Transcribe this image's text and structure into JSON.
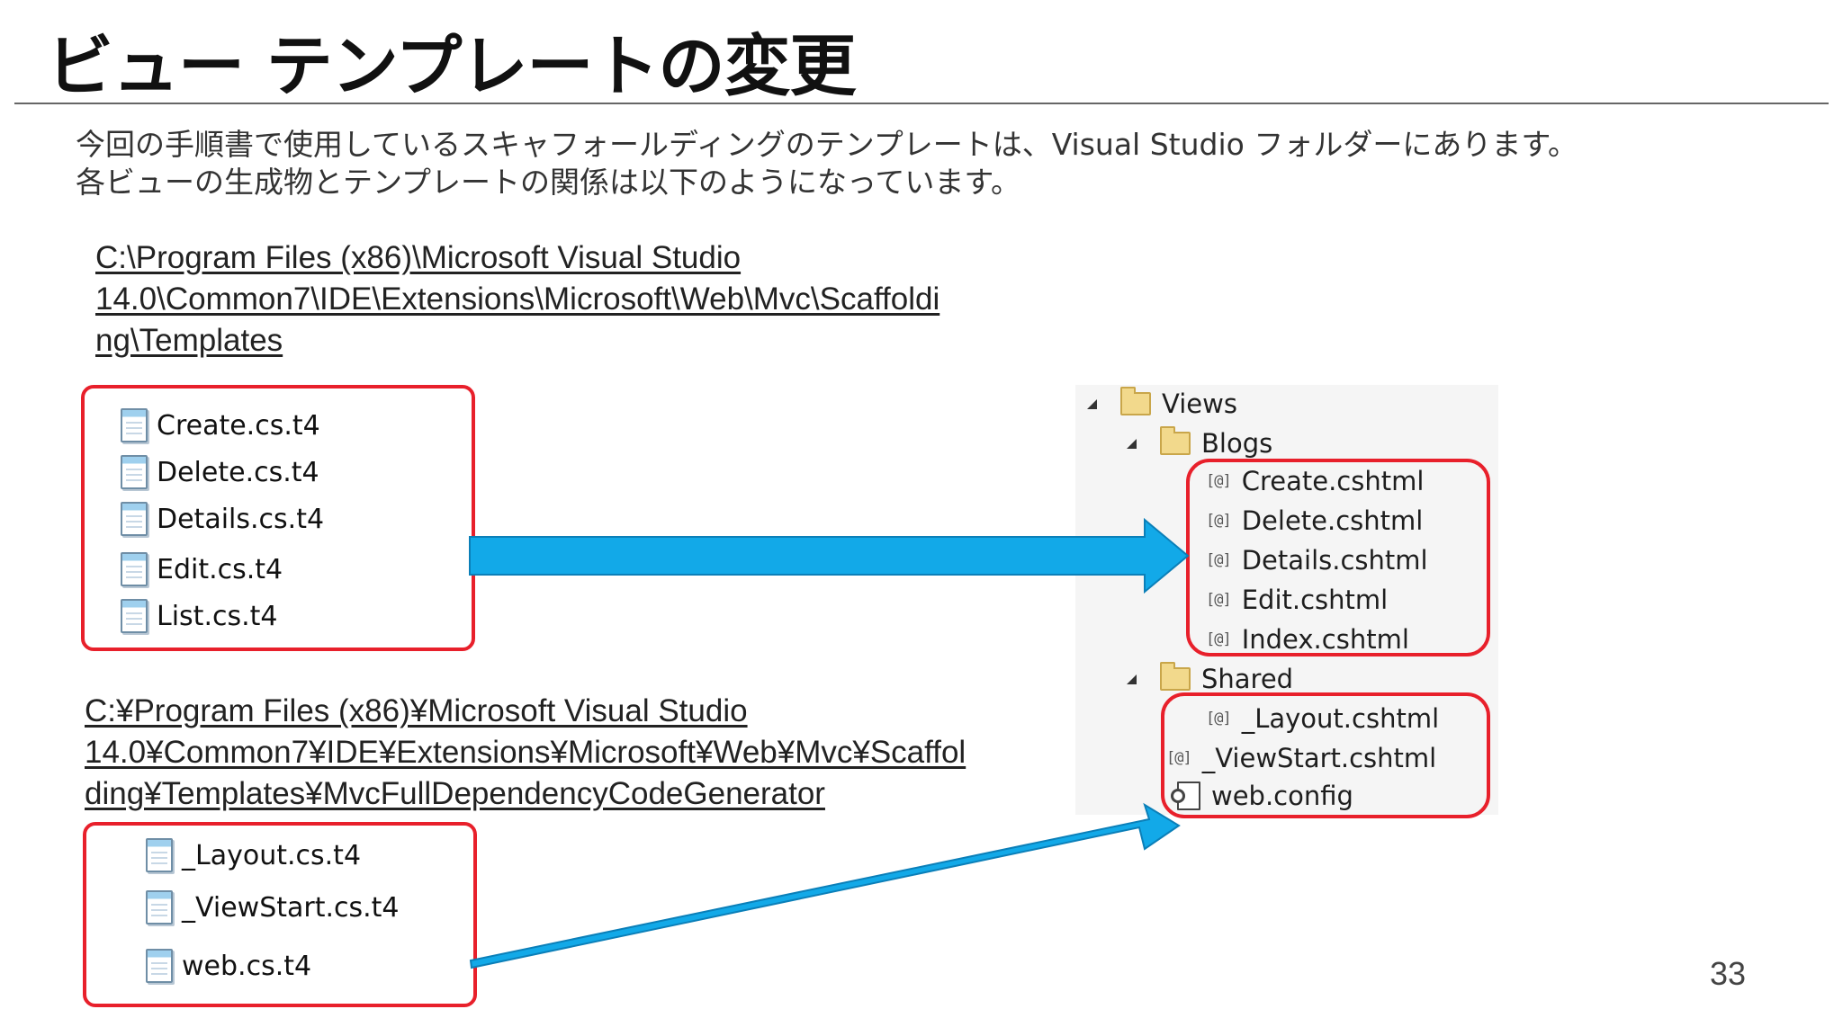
{
  "slide": {
    "title": "ビュー テンプレートの変更",
    "intro": [
      "今回の手順書で使用しているスキャフォールディングのテンプレートは、Visual Studio フォルダーにあります。",
      "各ビューの生成物とテンプレートの関係は以下のようになっています。"
    ],
    "page_number": "33"
  },
  "path1": [
    "C:\\Program Files (x86)\\Microsoft Visual Studio",
    "14.0\\Common7\\IDE\\Extensions\\Microsoft\\Web\\Mvc\\Scaffoldi",
    "ng\\Templates"
  ],
  "path2": [
    "C:¥Program Files (x86)¥Microsoft Visual Studio",
    "14.0¥Common7¥IDE¥Extensions¥Microsoft¥Web¥Mvc¥Scaffol",
    "ding¥Templates¥MvcFullDependencyCodeGenerator"
  ],
  "templates1": [
    "Create.cs.t4",
    "Delete.cs.t4",
    "Details.cs.t4",
    "Edit.cs.t4",
    "List.cs.t4"
  ],
  "templates2": [
    "_Layout.cs.t4",
    "_ViewStart.cs.t4",
    "web.cs.t4"
  ],
  "explorer": {
    "views": "Views",
    "blogs": "Blogs",
    "blogs_files": [
      "Create.cshtml",
      "Delete.cshtml",
      "Details.cshtml",
      "Edit.cshtml",
      "Index.cshtml"
    ],
    "shared": "Shared",
    "shared_files": [
      "_Layout.cshtml",
      "_ViewStart.cshtml",
      "web.config"
    ],
    "razor_glyph": "[@]"
  },
  "colors": {
    "highlight": "#e8202b",
    "arrow": "#12a9e8",
    "arrow_edge": "#0b7fb8"
  },
  "icons": {
    "template_file": "notepad-icon",
    "folder": "folder-icon",
    "razor_file": "razor-icon",
    "config_file": "config-icon"
  }
}
